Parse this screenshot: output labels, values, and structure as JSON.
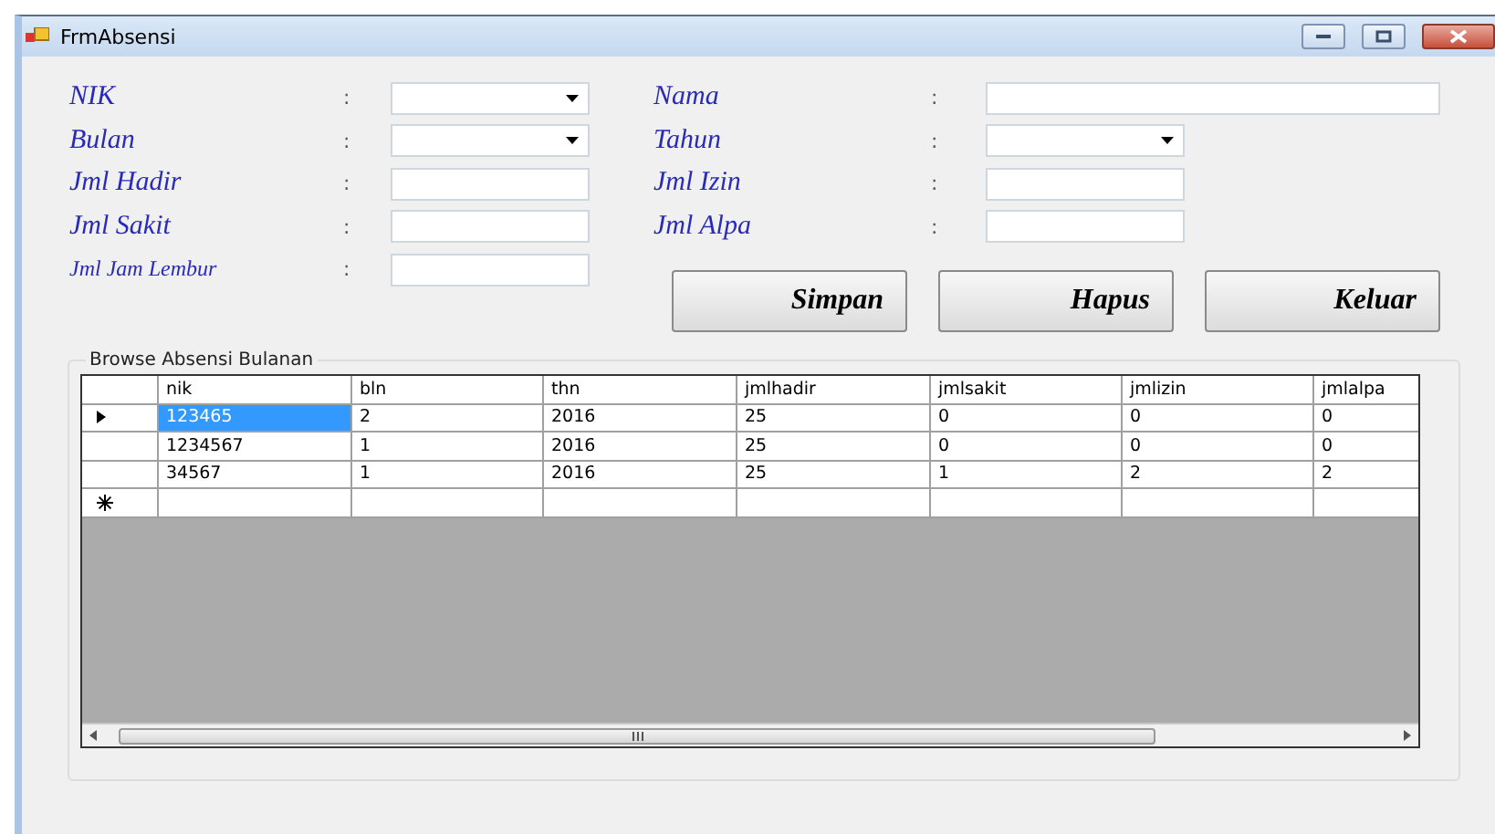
{
  "window": {
    "title": "FrmAbsensi"
  },
  "left_fields": [
    {
      "label": "NIK",
      "kind": "combo"
    },
    {
      "label": "Bulan",
      "kind": "combo"
    },
    {
      "label": "Jml Hadir",
      "kind": "text"
    },
    {
      "label": "Jml Sakit",
      "kind": "text"
    },
    {
      "label": "Jml Jam Lembur",
      "kind": "text"
    }
  ],
  "right_fields": [
    {
      "label": "Nama",
      "kind": "wide"
    },
    {
      "label": "Tahun",
      "kind": "combo"
    },
    {
      "label": "Jml Izin",
      "kind": "text"
    },
    {
      "label": "Jml Alpa",
      "kind": "text"
    }
  ],
  "colon": ":",
  "buttons": [
    "Simpan",
    "Hapus",
    "Keluar"
  ],
  "group": {
    "title": "Browse Absensi Bulanan"
  },
  "table": {
    "columns": [
      "nik",
      "bln",
      "thn",
      "jmlhadir",
      "jmlsakit",
      "jmlizin",
      "jmlalpa"
    ],
    "rows": [
      {
        "cells": [
          "123465",
          "2",
          "2016",
          "25",
          "0",
          "0",
          "0"
        ],
        "selected": true
      },
      {
        "cells": [
          "1234567",
          "1",
          "2016",
          "25",
          "0",
          "0",
          "0"
        ],
        "selected": false
      },
      {
        "cells": [
          "34567",
          "1",
          "2016",
          "25",
          "1",
          "2",
          "2"
        ],
        "selected": false
      }
    ]
  }
}
